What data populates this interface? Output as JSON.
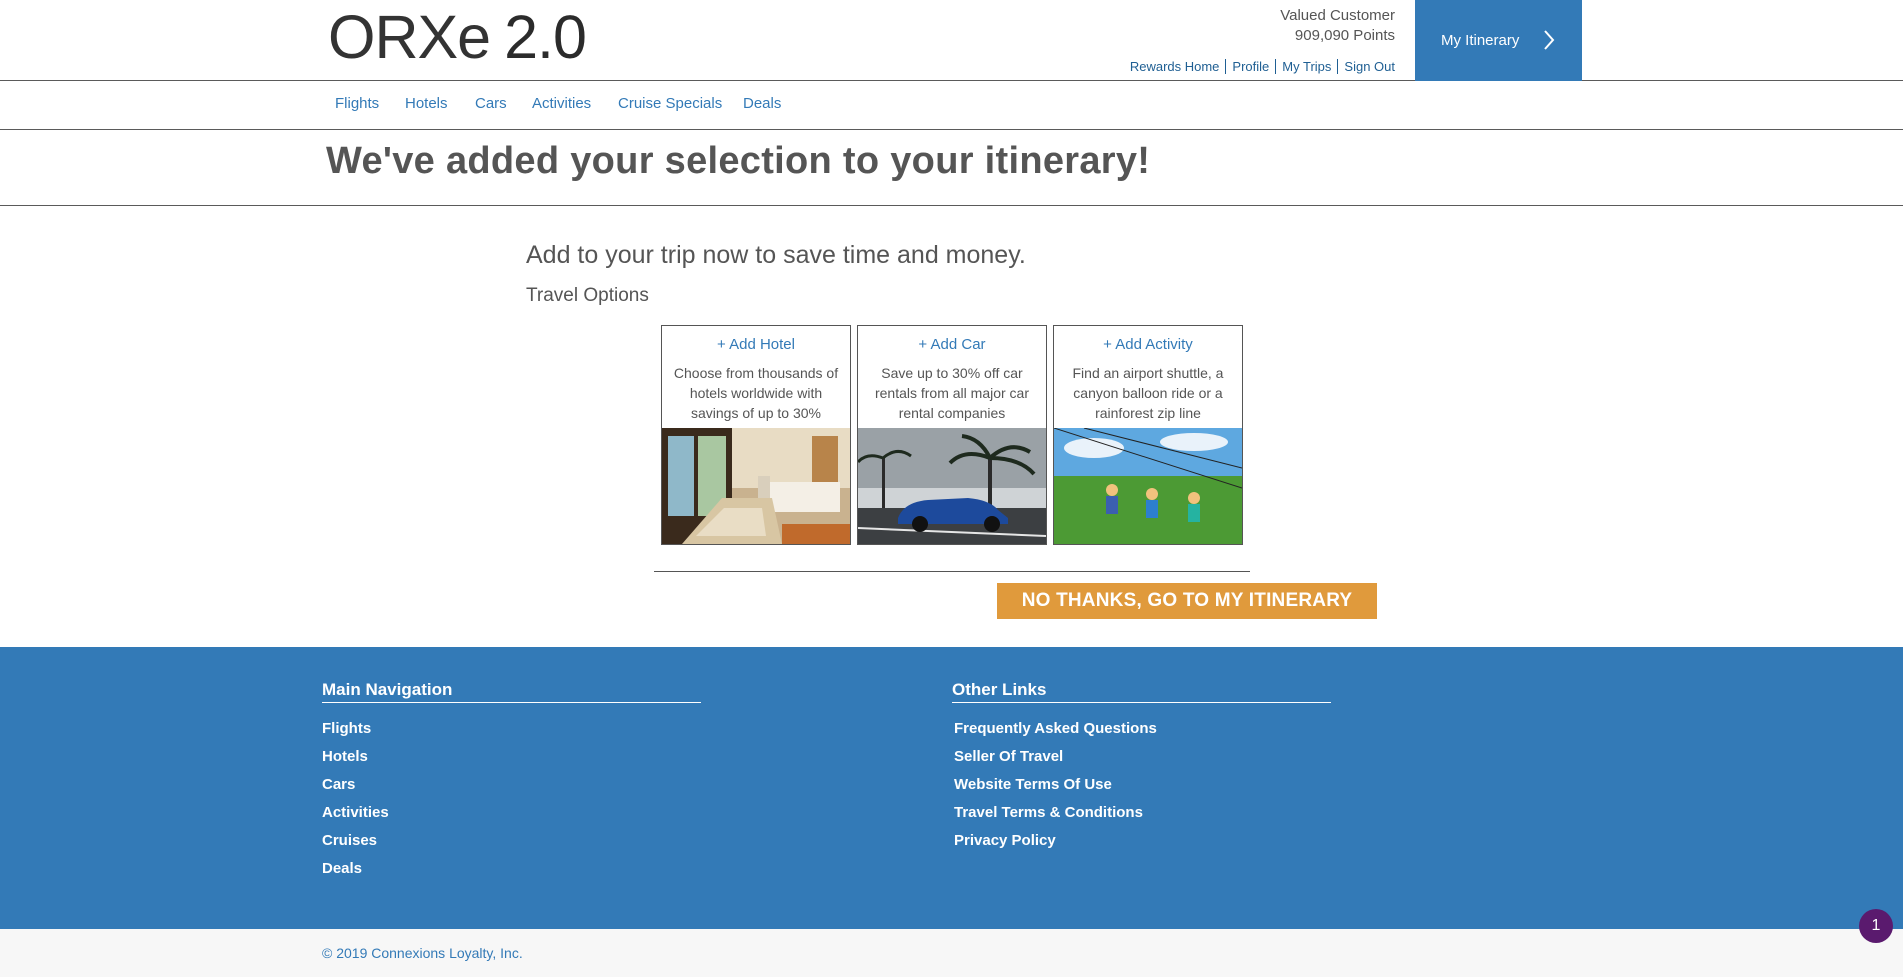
{
  "header": {
    "logo_main": "ORXe",
    "logo_version": "2.0",
    "user_name": "Valued Customer",
    "points": "909,090 Points",
    "links": [
      "Rewards Home",
      "Profile",
      "My Trips",
      "Sign Out"
    ],
    "itinerary_button": "My Itinerary"
  },
  "nav": {
    "items": [
      "Flights",
      "Hotels",
      "Cars",
      "Activities",
      "Cruise Specials",
      "Deals"
    ]
  },
  "page": {
    "title": "We've added your selection to your itinerary!",
    "subhead": "Add to your trip now to save time and money.",
    "options_label": "Travel Options"
  },
  "cards": [
    {
      "link": "+ Add Hotel",
      "desc": "Choose from thousands of hotels worldwide with savings of up to 30%",
      "image": "hotel-room-photo"
    },
    {
      "link": "+ Add Car",
      "desc": "Save up to 30% off car rentals from all major car rental companies",
      "image": "blue-convertible-car-photo"
    },
    {
      "link": "+ Add Activity",
      "desc": "Find an airport shuttle, a canyon balloon ride or a rainforest zip line",
      "image": "zip-line-activity-photo"
    }
  ],
  "actions": {
    "no_thanks": "NO THANKS, GO TO MY ITINERARY"
  },
  "footer": {
    "main_nav_heading": "Main Navigation",
    "main_nav": [
      "Flights",
      "Hotels",
      "Cars",
      "Activities",
      "Cruises",
      "Deals"
    ],
    "other_heading": "Other Links",
    "other_links": [
      "Frequently Asked Questions",
      "Seller Of Travel",
      "Website Terms Of Use",
      "Travel Terms & Conditions",
      "Privacy Policy"
    ],
    "copyright": "© 2019 Connexions Loyalty, Inc."
  },
  "badge": {
    "count": "1"
  },
  "colors": {
    "brand_blue": "#337ab7",
    "cta_orange": "#e09a3c",
    "badge_purple": "#5a1a6e"
  }
}
